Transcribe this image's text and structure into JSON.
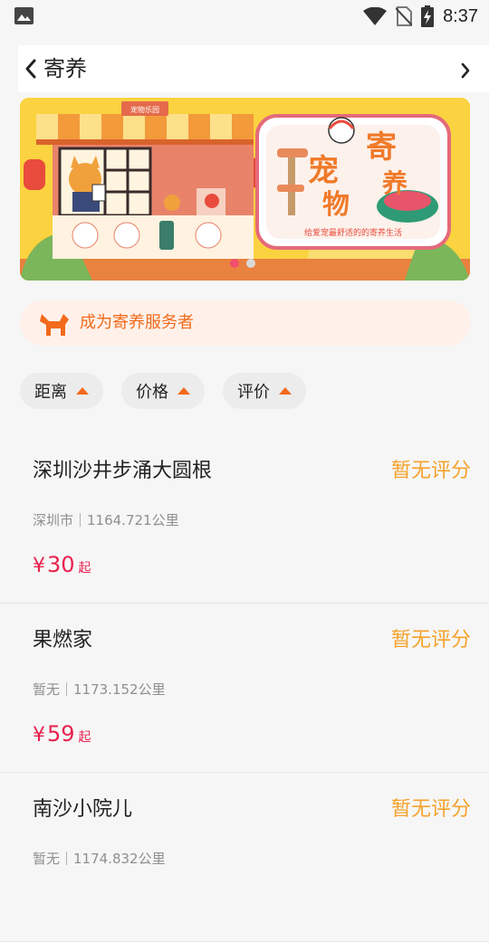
{
  "status_bar": {
    "time": "8:37"
  },
  "nav": {
    "title": "寄养"
  },
  "banner": {
    "shop_sign": "宠物乐园",
    "headline_chars": [
      "寄",
      "养",
      "宠",
      "物"
    ],
    "slogan": "给爱宠最舒适的的寄养生活",
    "active_slide": 1,
    "slide_count": 2
  },
  "become_provider": {
    "label": "成为寄养服务者"
  },
  "filters": [
    {
      "label": "距离"
    },
    {
      "label": "价格"
    },
    {
      "label": "评价"
    }
  ],
  "listings": [
    {
      "name": "深圳沙井步涌大圆根",
      "rating": "暂无评分",
      "meta": "深圳市｜1164.721公里",
      "currency": "¥",
      "price": "30",
      "price_suffix": "起"
    },
    {
      "name": "果燃家",
      "rating": "暂无评分",
      "meta": "暂无｜1173.152公里",
      "currency": "¥",
      "price": "59",
      "price_suffix": "起"
    },
    {
      "name": "南沙小院儿",
      "rating": "暂无评分",
      "meta": "暂无｜1174.832公里",
      "currency": "",
      "price": "",
      "price_suffix": ""
    }
  ],
  "colors": {
    "accent_orange": "#f26a1b",
    "rating": "#f5a22b",
    "price": "#e8214f",
    "banner_yellow": "#fbd23f"
  }
}
